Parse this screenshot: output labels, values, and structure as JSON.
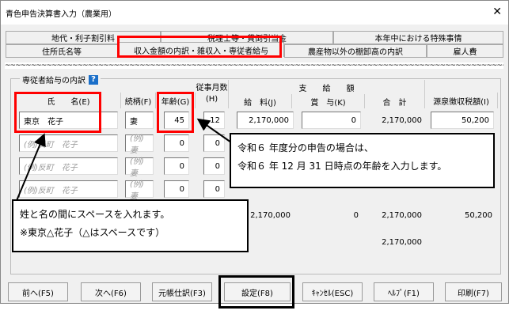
{
  "window": {
    "title": "青色申告決算書入力（農業用）",
    "close": "✕"
  },
  "tabs": {
    "row1": [
      "地代・利子割引料",
      "税理士等・貸倒引当金",
      "本年中における特殊事情"
    ],
    "row2": [
      "住所氏名等",
      "収入金額の内訳・雑収入・専従者給与",
      "農産物以外の棚卸高の内訳",
      "雇人費"
    ]
  },
  "group": {
    "label": "専従者給与の内訳",
    "help": "?"
  },
  "headers": {
    "name": "氏　　名(E)",
    "relation": "続柄(F)",
    "age": "年齢(G)",
    "months": "従事月数(H)",
    "pay": "支　　給　　額",
    "salary": "給　料(J)",
    "bonus": "賞　与(K)",
    "total": "合　計",
    "tax": "源泉徴収税額(I)"
  },
  "rows": [
    {
      "name": "東京　花子",
      "relation": "妻",
      "age": "45",
      "months": "12",
      "salary": "2,170,000",
      "bonus": "0",
      "total": "2,170,000",
      "tax": "50,200"
    },
    {
      "name_placeholder": "(例)反町　花子",
      "relation_placeholder": "(例)妻",
      "age": "0",
      "months": "0"
    },
    {
      "name_placeholder": "(例)反町　花子",
      "relation_placeholder": "(例)妻",
      "age": "0",
      "months": "0"
    },
    {
      "name_placeholder": "(例)反町　花子",
      "relation_placeholder": "(例)妻",
      "age": "0",
      "months": "0"
    }
  ],
  "totals": {
    "salary": "2,170,000",
    "bonus": "0",
    "total": "2,170,000",
    "tax": "50,200",
    "grand_total": "2,170,000"
  },
  "buttons": [
    "前へ(F5)",
    "次へ(F6)",
    "元帳仕訳(F3)",
    "設定(F8)",
    "ｷｬﾝｾﾙ(ESC)",
    "ﾍﾙﾌﾟ(F1)",
    "印刷(F7)"
  ],
  "callouts": {
    "age": [
      "令和６ 年度分の申告の場合は、",
      "令和６ 年 12 月 31 日時点の年齢を入力します。"
    ],
    "name": [
      "姓と名の間にスペースを入れます。",
      "※東京△花子（△はスペースです）"
    ]
  },
  "colors": {
    "highlight": "#ff0000",
    "help": "#1a6fc9"
  }
}
